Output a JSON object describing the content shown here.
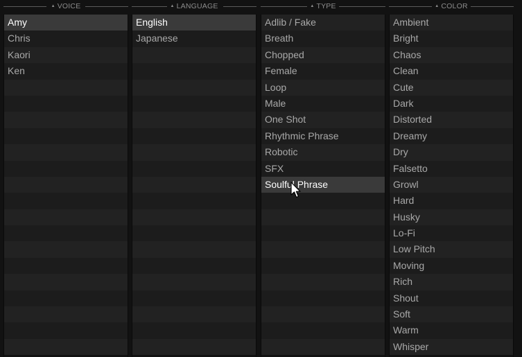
{
  "columns": [
    {
      "id": "voice",
      "title": "VOICE",
      "items": [
        "Amy",
        "Chris",
        "Kaori",
        "Ken"
      ],
      "selected": 0
    },
    {
      "id": "language",
      "title": "LANGUAGE",
      "items": [
        "English",
        "Japanese"
      ],
      "selected": 0
    },
    {
      "id": "type",
      "title": "TYPE",
      "items": [
        "Adlib / Fake",
        "Breath",
        "Chopped",
        "Female",
        "Loop",
        "Male",
        "One Shot",
        "Rhythmic Phrase",
        "Robotic",
        "SFX",
        "Soulful Phrase"
      ],
      "hovered": 10
    },
    {
      "id": "color",
      "title": "COLOR",
      "items": [
        "Ambient",
        "Bright",
        "Chaos",
        "Clean",
        "Cute",
        "Dark",
        "Distorted",
        "Dreamy",
        "Dry",
        "Falsetto",
        "Growl",
        "Hard",
        "Husky",
        "Lo-Fi",
        "Low Pitch",
        "Moving",
        "Rich",
        "Shout",
        "Soft",
        "Warm",
        "Whisper"
      ]
    }
  ],
  "icons": {
    "sort": "sort-ascending-triangle-icon",
    "cursor": "mouse-pointer-icon"
  },
  "colors": {
    "background": "#121212",
    "row_odd": "#222222",
    "row_even": "#1c1c1c",
    "row_selected": "#3a3a3a",
    "text": "#a9a9a9",
    "text_selected": "#ffffff",
    "header_text": "#8c8c8c"
  }
}
